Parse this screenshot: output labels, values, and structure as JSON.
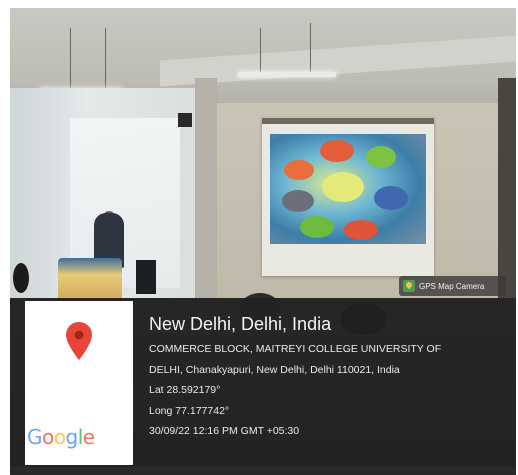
{
  "photo": {
    "description_label": "classroom-presentation-photo"
  },
  "badge": {
    "label": "GPS Map Camera",
    "icon": "gps-map-camera-icon"
  },
  "map": {
    "pin_icon": "map-pin-icon",
    "logo_letters": [
      "G",
      "o",
      "o",
      "g",
      "l",
      "e"
    ],
    "pin_color": "#e8443a"
  },
  "location": {
    "place": "New Delhi, Delhi, India",
    "address_line1": "COMMERCE BLOCK, MAITREYI COLLEGE UNIVERSITY OF",
    "address_line2": "DELHI, Chanakyapuri, New Delhi, Delhi 110021, India",
    "lat": "Lat 28.592179°",
    "long": "Long 77.177742°",
    "datetime": "30/09/22 12:16 PM GMT +05:30"
  }
}
